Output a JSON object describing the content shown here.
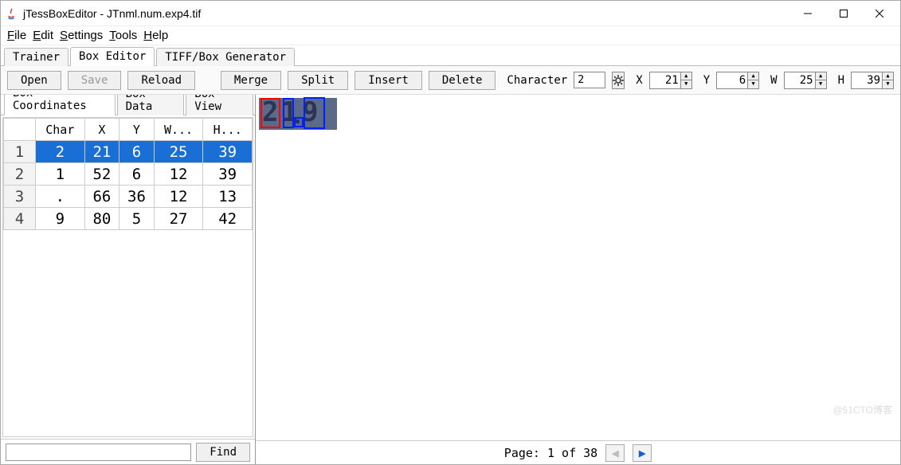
{
  "window": {
    "title": "jTessBoxEditor - JTnml.num.exp4.tif"
  },
  "menubar": [
    "File",
    "Edit",
    "Settings",
    "Tools",
    "Help"
  ],
  "main_tabs": [
    {
      "label": "Trainer",
      "active": false
    },
    {
      "label": "Box Editor",
      "active": true
    },
    {
      "label": "TIFF/Box Generator",
      "active": false
    }
  ],
  "toolbar": {
    "open": "Open",
    "save": "Save",
    "reload": "Reload",
    "merge": "Merge",
    "split": "Split",
    "insert": "Insert",
    "delete": "Delete",
    "character_label": "Character",
    "character_value": "2",
    "x_label": "X",
    "x_value": "21",
    "y_label": "Y",
    "y_value": "6",
    "w_label": "W",
    "w_value": "25",
    "h_label": "H",
    "h_value": "39"
  },
  "sub_tabs": [
    {
      "label": "Box Coordinates",
      "active": true
    },
    {
      "label": "Box Data",
      "active": false
    },
    {
      "label": "Box View",
      "active": false
    }
  ],
  "table": {
    "headers": [
      "",
      "Char",
      "X",
      "Y",
      "W...",
      "H..."
    ],
    "rows": [
      {
        "n": "1",
        "char": "2",
        "x": "21",
        "y": "6",
        "w": "25",
        "h": "39",
        "selected": true
      },
      {
        "n": "2",
        "char": "1",
        "x": "52",
        "y": "6",
        "w": "12",
        "h": "39",
        "selected": false
      },
      {
        "n": "3",
        "char": ".",
        "x": "66",
        "y": "36",
        "w": "12",
        "h": "13",
        "selected": false
      },
      {
        "n": "4",
        "char": "9",
        "x": "80",
        "y": "5",
        "w": "27",
        "h": "42",
        "selected": false
      }
    ]
  },
  "find": {
    "label": "Find",
    "value": ""
  },
  "pager": {
    "text": "Page: 1 of 38"
  },
  "image_text": "21.9",
  "watermark": "@51CTO博客"
}
